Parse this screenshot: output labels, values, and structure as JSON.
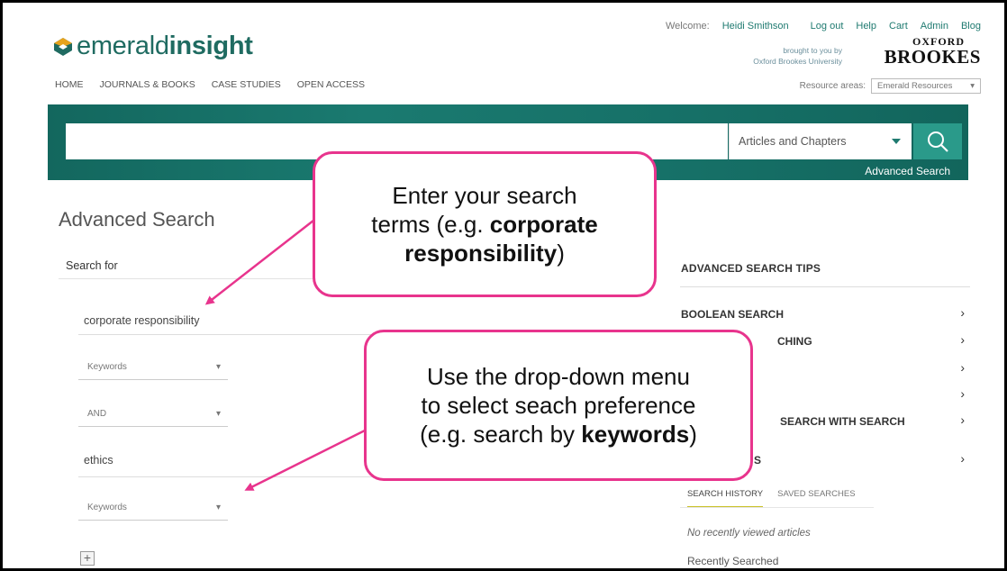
{
  "header": {
    "logo": {
      "prefix": "emerald",
      "bold": "insight",
      "mark_color": "#1f6b61",
      "mark_accent": "#e7a31c"
    },
    "nav": [
      "HOME",
      "JOURNALS & BOOKS",
      "CASE STUDIES",
      "OPEN ACCESS"
    ],
    "welcome": "Welcome:",
    "user_name": "Heidi Smithson",
    "links": [
      "Log out",
      "Help",
      "Cart",
      "Admin",
      "Blog"
    ],
    "brought_by_line1": "brought to you by",
    "brought_by_line2": "Oxford Brookes University",
    "institution_line1": "OXFORD",
    "institution_line2": "BROOKES",
    "resource_label": "Resource areas:",
    "resource_value": "Emerald Resources"
  },
  "search_bar": {
    "query": "",
    "type": "Articles and Chapters",
    "search_icon": "search-icon",
    "advanced_link": "Advanced Search",
    "accent_color": "#1a7a70"
  },
  "advanced": {
    "title": "Advanced Search",
    "search_for_label": "Search for",
    "rows": [
      {
        "term": "corporate responsibility",
        "field": "Keywords"
      },
      {
        "operator": "AND"
      },
      {
        "term": "ethics",
        "field": "Keywords"
      }
    ],
    "add_icon": "plus-icon"
  },
  "tips": {
    "title": "ADVANCED SEARCH TIPS",
    "items": [
      {
        "label": "BOOLEAN SEARCH"
      },
      {
        "label": "CHING"
      },
      {
        "label": ""
      },
      {
        "label": ""
      },
      {
        "label": "SEARCH WITH SEARCH"
      },
      {
        "label": "S"
      }
    ],
    "chevron_icon": "chevron-right-icon"
  },
  "history": {
    "tabs": [
      "SEARCH HISTORY",
      "SAVED SEARCHES"
    ],
    "empty_text": "No recently viewed articles",
    "recent_label": "Recently Searched"
  },
  "callouts": [
    {
      "line1": "Enter your search",
      "line2_prefix": "terms (e.g. ",
      "line2_bold": "corporate",
      "line3_bold": "responsibility",
      "line3_suffix": ")"
    },
    {
      "line1": "Use the drop-down menu",
      "line2": "to select seach preference",
      "line3_prefix": "(e.g. search by ",
      "line3_bold": "keywords",
      "line3_suffix": ")"
    }
  ],
  "colors": {
    "callout_border": "#e8348d",
    "arrow": "#e8348d",
    "tab_underline": "#c9c227"
  }
}
